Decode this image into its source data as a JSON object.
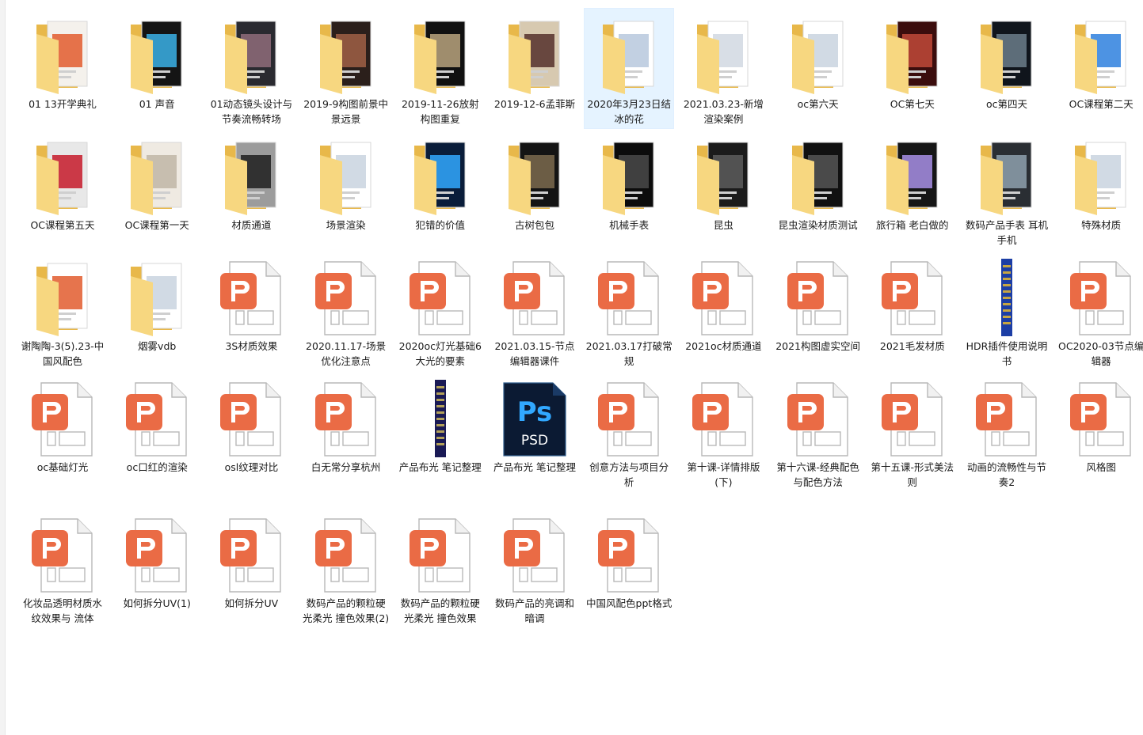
{
  "colors": {
    "folder_back": "#e8b84a",
    "folder_front": "#f7d780",
    "pptx_orange": "#ea6b45",
    "ps_blue": "#31a8ff",
    "ps_bg": "#0b1a33",
    "selection": "#e5f3ff"
  },
  "items": [
    {
      "label": "01 13开学典礼",
      "type": "folder",
      "preview": [
        "#f4f1ec",
        "#e25c2e"
      ]
    },
    {
      "label": "01 声音",
      "type": "folder",
      "preview": [
        "#141414",
        "#3ab0e6"
      ]
    },
    {
      "label": "01动态镜头设计与节奏流畅转场",
      "type": "folder",
      "preview": [
        "#2a2a30",
        "#8f6c7a"
      ]
    },
    {
      "label": "2019-9构图前景中景远景",
      "type": "folder",
      "preview": [
        "#2b1f1b",
        "#a06045"
      ]
    },
    {
      "label": "2019-11-26放射构图重复",
      "type": "folder",
      "preview": [
        "#111111",
        "#b9a37e"
      ]
    },
    {
      "label": "2019-12-6孟菲斯",
      "type": "folder",
      "preview": [
        "#d7c9b0",
        "#55302c"
      ]
    },
    {
      "label": "2020年3月23日结冰的花",
      "type": "folder",
      "preview": [
        "#ffffff",
        "#b7c8dd"
      ],
      "selected": true
    },
    {
      "label": "2021.03.23-新增渲染案例",
      "type": "folder",
      "preview": [
        "#ffffff",
        "#d1d8e2"
      ]
    },
    {
      "label": "oc第六天",
      "type": "folder",
      "preview": [
        "#ffffff",
        "#c9d3df"
      ]
    },
    {
      "label": "OC第七天",
      "type": "folder",
      "preview": [
        "#3b0d0d",
        "#c14a3a"
      ]
    },
    {
      "label": "oc第四天",
      "type": "folder",
      "preview": [
        "#10151c",
        "#6b7c8a"
      ]
    },
    {
      "label": "OC课程第二天",
      "type": "folder",
      "preview": [
        "#ffffff",
        "#2e80de"
      ]
    },
    {
      "label": "OC课程第五天",
      "type": "folder",
      "preview": [
        "#e8e8e8",
        "#c61a2a"
      ]
    },
    {
      "label": "OC课程第一天",
      "type": "folder",
      "preview": [
        "#efeae2",
        "#bfb6a6"
      ]
    },
    {
      "label": "材质通道",
      "type": "folder",
      "preview": [
        "#9c9c9c",
        "#1f1f1f"
      ]
    },
    {
      "label": "场景渲染",
      "type": "folder",
      "preview": [
        "#ffffff",
        "#c9d3df"
      ]
    },
    {
      "label": "犯错的价值",
      "type": "folder",
      "preview": [
        "#0a1d3a",
        "#31a8ff"
      ]
    },
    {
      "label": "古树包包",
      "type": "folder",
      "preview": [
        "#141414",
        "#7b6a4e"
      ]
    },
    {
      "label": "机械手表",
      "type": "folder",
      "preview": [
        "#0c0c0c",
        "#4a4a4a"
      ]
    },
    {
      "label": "昆虫",
      "type": "folder",
      "preview": [
        "#1b1b1b",
        "#5c5c5c"
      ]
    },
    {
      "label": "昆虫渲染材质测试",
      "type": "folder",
      "preview": [
        "#111111",
        "#555555"
      ]
    },
    {
      "label": "旅行箱 老白做的",
      "type": "folder",
      "preview": [
        "#161616",
        "#a88fe6"
      ]
    },
    {
      "label": "数码产品手表 耳机 手机",
      "type": "folder",
      "preview": [
        "#2a2e33",
        "#8ea0ae"
      ]
    },
    {
      "label": "特殊材质",
      "type": "folder",
      "preview": [
        "#ffffff",
        "#c9d3df"
      ]
    },
    {
      "label": "谢陶陶-3(5).23-中国风配色",
      "type": "folder",
      "preview": [
        "#ffffff",
        "#e25c2e"
      ]
    },
    {
      "label": "烟雾vdb",
      "type": "folder",
      "preview": [
        "#ffffff",
        "#c9d3df"
      ]
    },
    {
      "label": "3S材质效果",
      "type": "pptx"
    },
    {
      "label": "2020.11.17-场景优化注意点",
      "type": "pptx"
    },
    {
      "label": "2020oc灯光基础6大光的要素",
      "type": "pptx"
    },
    {
      "label": "2021.03.15-节点编辑器课件",
      "type": "pptx"
    },
    {
      "label": "2021.03.17打破常规",
      "type": "pptx"
    },
    {
      "label": "2021oc材质通道",
      "type": "pptx"
    },
    {
      "label": "2021构图虚实空间",
      "type": "pptx"
    },
    {
      "label": "2021毛发材质",
      "type": "pptx"
    },
    {
      "label": "HDR插件使用说明书",
      "type": "longimage",
      "preview": [
        "#1c3ea5",
        "#f2c029"
      ]
    },
    {
      "label": "OC2020-03节点编辑器",
      "type": "pptx"
    },
    {
      "label": "oc基础灯光",
      "type": "pptx"
    },
    {
      "label": "oc口红的渲染",
      "type": "pptx"
    },
    {
      "label": "osl纹理对比",
      "type": "pptx"
    },
    {
      "label": "白无常分享杭州",
      "type": "pptx"
    },
    {
      "label": "产品布光 笔记整理",
      "type": "longimage",
      "preview": [
        "#1a1a55",
        "#d9c35a"
      ]
    },
    {
      "label": "产品布光 笔记整理",
      "type": "psd",
      "ps": "Ps",
      "psd": "PSD"
    },
    {
      "label": "创意方法与项目分析",
      "type": "pptx"
    },
    {
      "label": "第十课-详情排版(下)",
      "type": "pptx"
    },
    {
      "label": "第十六课-经典配色与配色方法",
      "type": "pptx"
    },
    {
      "label": "第十五课-形式美法则",
      "type": "pptx"
    },
    {
      "label": "动画的流畅性与节奏2",
      "type": "pptx"
    },
    {
      "label": "风格图",
      "type": "pptx"
    },
    {
      "label": "化妆品透明材质水纹效果与 流体",
      "type": "pptx"
    },
    {
      "label": "如何拆分UV(1)",
      "type": "pptx"
    },
    {
      "label": "如何拆分UV",
      "type": "pptx"
    },
    {
      "label": "数码产品的颗粒硬光柔光 撞色效果(2)",
      "type": "pptx"
    },
    {
      "label": "数码产品的颗粒硬光柔光 撞色效果",
      "type": "pptx"
    },
    {
      "label": "数码产品的亮调和暗调",
      "type": "pptx"
    },
    {
      "label": "中国风配色ppt格式",
      "type": "pptx"
    }
  ]
}
